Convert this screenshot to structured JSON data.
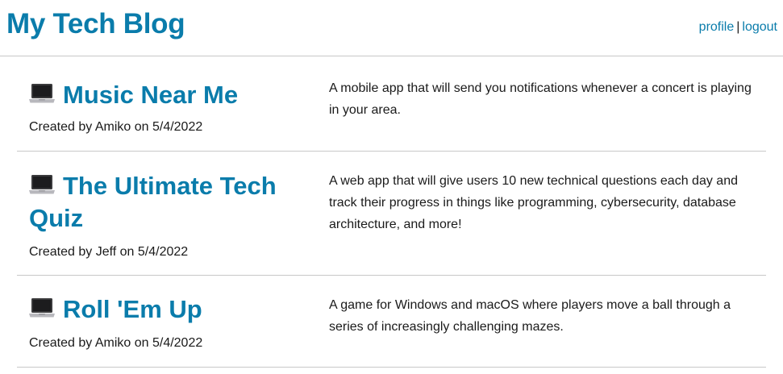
{
  "header": {
    "title": "My Tech Blog",
    "nav": {
      "profile": "profile",
      "separator": "|",
      "logout": "logout"
    }
  },
  "colors": {
    "accent": "#0a7cab",
    "divider": "#c8c8c8",
    "text": "#1a1a1a"
  },
  "posts": [
    {
      "icon": "laptop-icon",
      "title": "Music Near Me",
      "meta": "Created by Amiko on 5/4/2022",
      "description": "A mobile app that will send you notifications whenever a concert is playing in your area."
    },
    {
      "icon": "laptop-icon",
      "title": "The Ultimate Tech Quiz",
      "meta": "Created by Jeff on 5/4/2022",
      "description": "A web app that will give users 10 new technical questions each day and track their progress in things like programming, cybersecurity, database architecture, and more!"
    },
    {
      "icon": "laptop-icon",
      "title": "Roll 'Em Up",
      "meta": "Created by Amiko on 5/4/2022",
      "description": "A game for Windows and macOS where players move a ball through a series of increasingly challenging mazes."
    }
  ]
}
